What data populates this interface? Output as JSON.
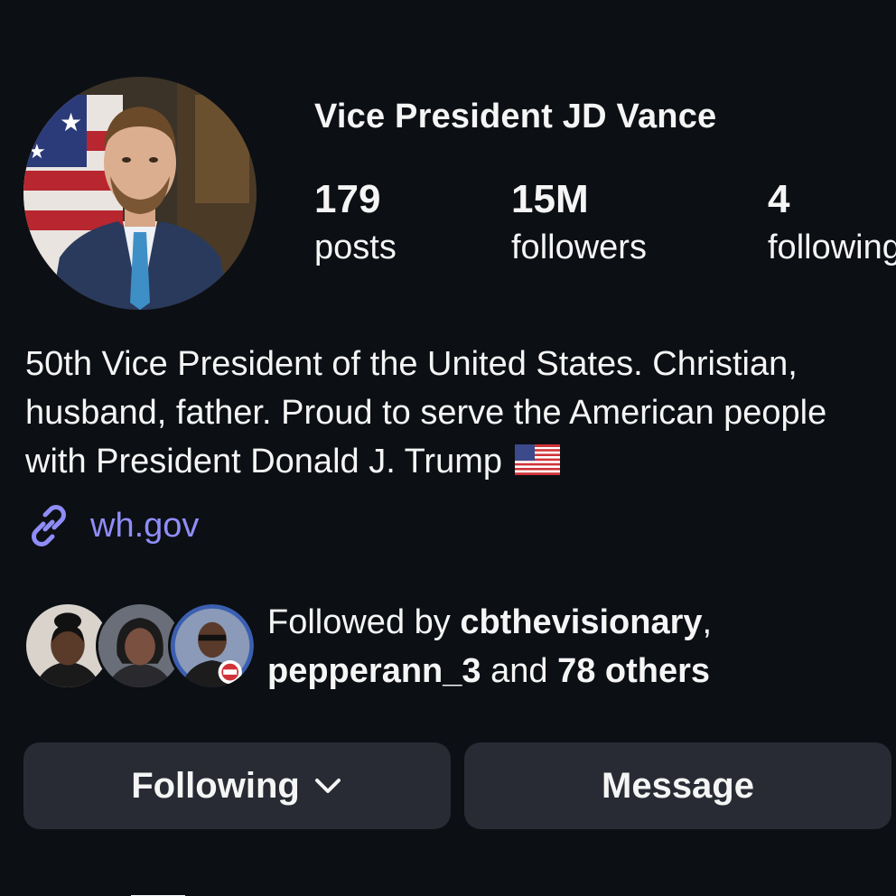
{
  "profile": {
    "display_name": "Vice President JD Vance",
    "avatar_icon": "profile-photo"
  },
  "stats": [
    {
      "value": "179",
      "label": "posts"
    },
    {
      "value": "15M",
      "label": "followers"
    },
    {
      "value": "4",
      "label": "following"
    }
  ],
  "bio": {
    "lines": [
      "50th Vice President of the United States. Christian,",
      "husband, father. Proud to serve the American people",
      "with President Donald J. Trump"
    ],
    "flag_icon": "us-flag-emoji"
  },
  "link": {
    "icon": "link-icon",
    "text": "wh.gov",
    "color": "#8f8df7"
  },
  "followed_by": {
    "prefix": "Followed by ",
    "user1": "cbthevisionary",
    "sep": ",",
    "user2": "pepperann_3",
    "middle": " and ",
    "others": "78 others"
  },
  "buttons": {
    "following_label": "Following",
    "message_label": "Message"
  },
  "colors": {
    "background": "#0c0f14",
    "button_bg": "#282b33",
    "link": "#8f8df7"
  }
}
